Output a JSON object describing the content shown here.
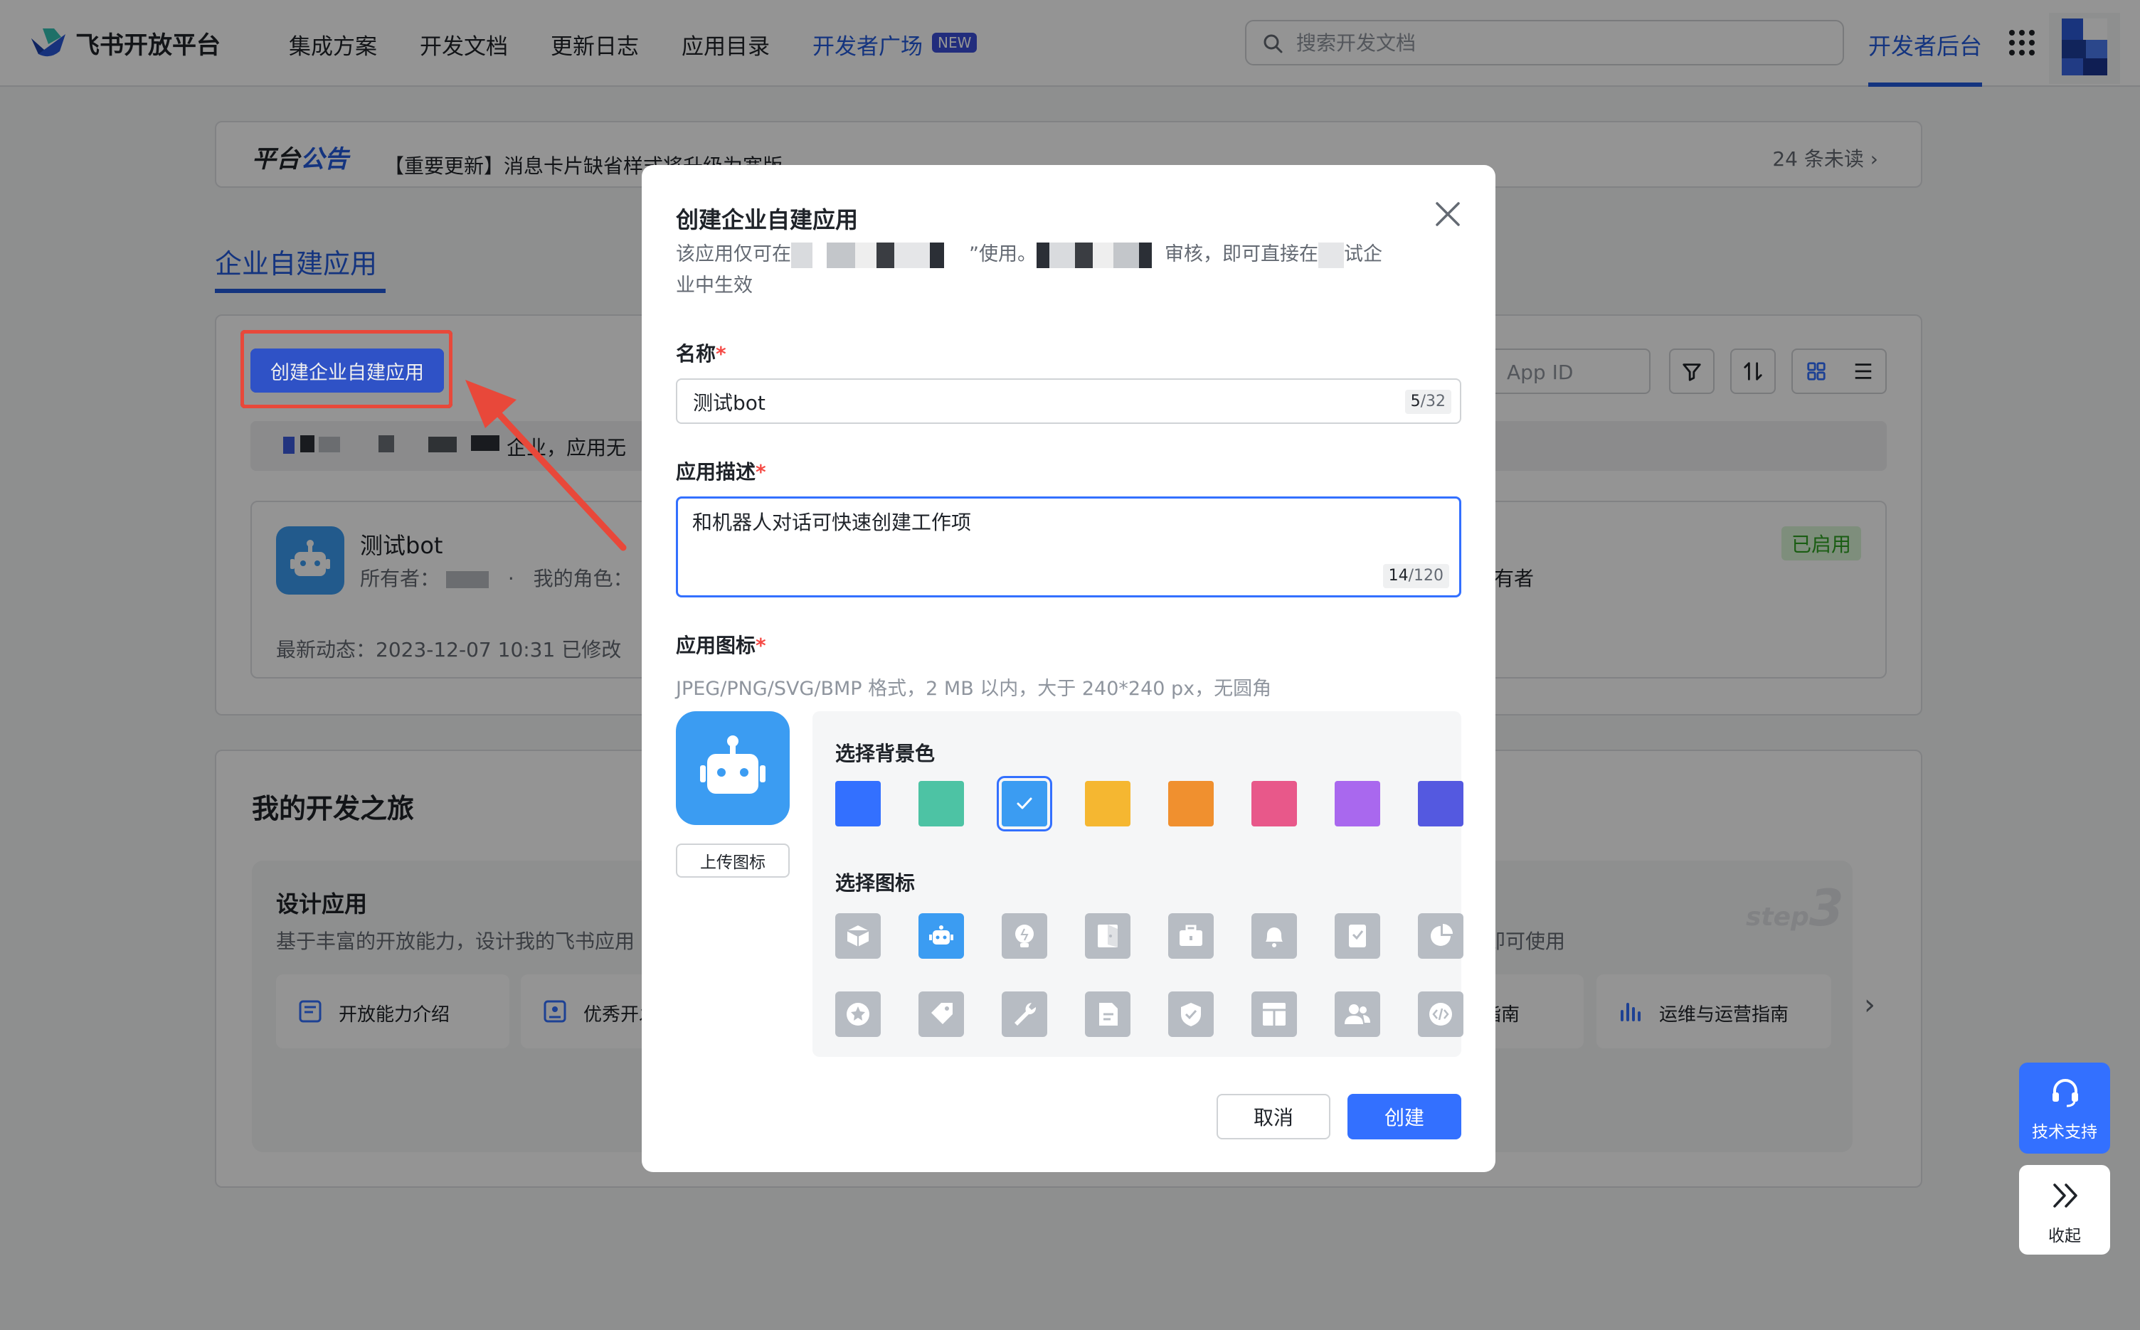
{
  "nav": {
    "brand": "飞书开放平台",
    "links": [
      "集成方案",
      "开发文档",
      "更新日志",
      "应用目录",
      "开发者广场"
    ],
    "new_badge": "NEW",
    "search_placeholder": "搜索开发文档",
    "dev_console": "开发者后台"
  },
  "notice": {
    "title_a": "平台",
    "title_b": "公告",
    "text": "【重要更新】消息卡片缺省样式将升级为宽版",
    "unread": "24 条未读 ›"
  },
  "section": {
    "title": "企业自建应用",
    "create_button": "创建企业自建应用",
    "info_text": "企业，应用无",
    "appid_placeholder": "App ID"
  },
  "app_card": {
    "name": "测试bot",
    "owner": "所有者：",
    "role": "我的角色：",
    "role_suffix": "有者",
    "status": "已启用",
    "updated": "最新动态：2023-12-07 10:31  已修改"
  },
  "journey": {
    "title": "我的开发之旅",
    "step_title": "设计应用",
    "step_desc": "基于丰富的开放能力，设计我的飞书应用",
    "step_label": "step",
    "step_number": "3",
    "step3_desc": "后即可使用",
    "chips": [
      "开放能力介绍",
      "优秀开发",
      "指南",
      "运维与运营指南"
    ],
    "next": "›"
  },
  "modal": {
    "title": "创建企业自建应用",
    "desc_a": "该应用仅可在",
    "desc_b": "”使用。",
    "desc_c": "审核，即可直接在",
    "desc_d": "试企",
    "desc_e": "业中生效",
    "name_label": "名称",
    "name_value": "测试bot",
    "name_count": "5",
    "name_max": "/32",
    "desc_label": "应用描述",
    "desc_value": "和机器人对话可快速创建工作项",
    "desc_count": "14",
    "desc_max": "/120",
    "icon_label": "应用图标",
    "icon_hint": "JPEG/PNG/SVG/BMP 格式，2 MB 以内，大于 240*240 px，无圆角",
    "upload_button": "上传图标",
    "bg_label": "选择背景色",
    "icon_pick_label": "选择图标",
    "bg_colors": [
      "#3370ff",
      "#4dc3a4",
      "#3b9cf2",
      "#f5b731",
      "#f0902f",
      "#e8588a",
      "#a968ee",
      "#5459e0"
    ],
    "selected_bg": 2,
    "icons": [
      "box-icon",
      "robot-icon",
      "bulb-icon",
      "door-icon",
      "briefcase-icon",
      "bell-icon",
      "bookmark-icon",
      "pie-icon",
      "star-icon",
      "tag-icon",
      "wrench-icon",
      "document-icon",
      "shield-icon",
      "layout-icon",
      "users-icon",
      "code-icon"
    ],
    "selected_icon": 1,
    "required_mark": "*",
    "cancel": "取消",
    "confirm": "创建"
  },
  "float": {
    "support": "技术支持",
    "collapse": "收起"
  }
}
